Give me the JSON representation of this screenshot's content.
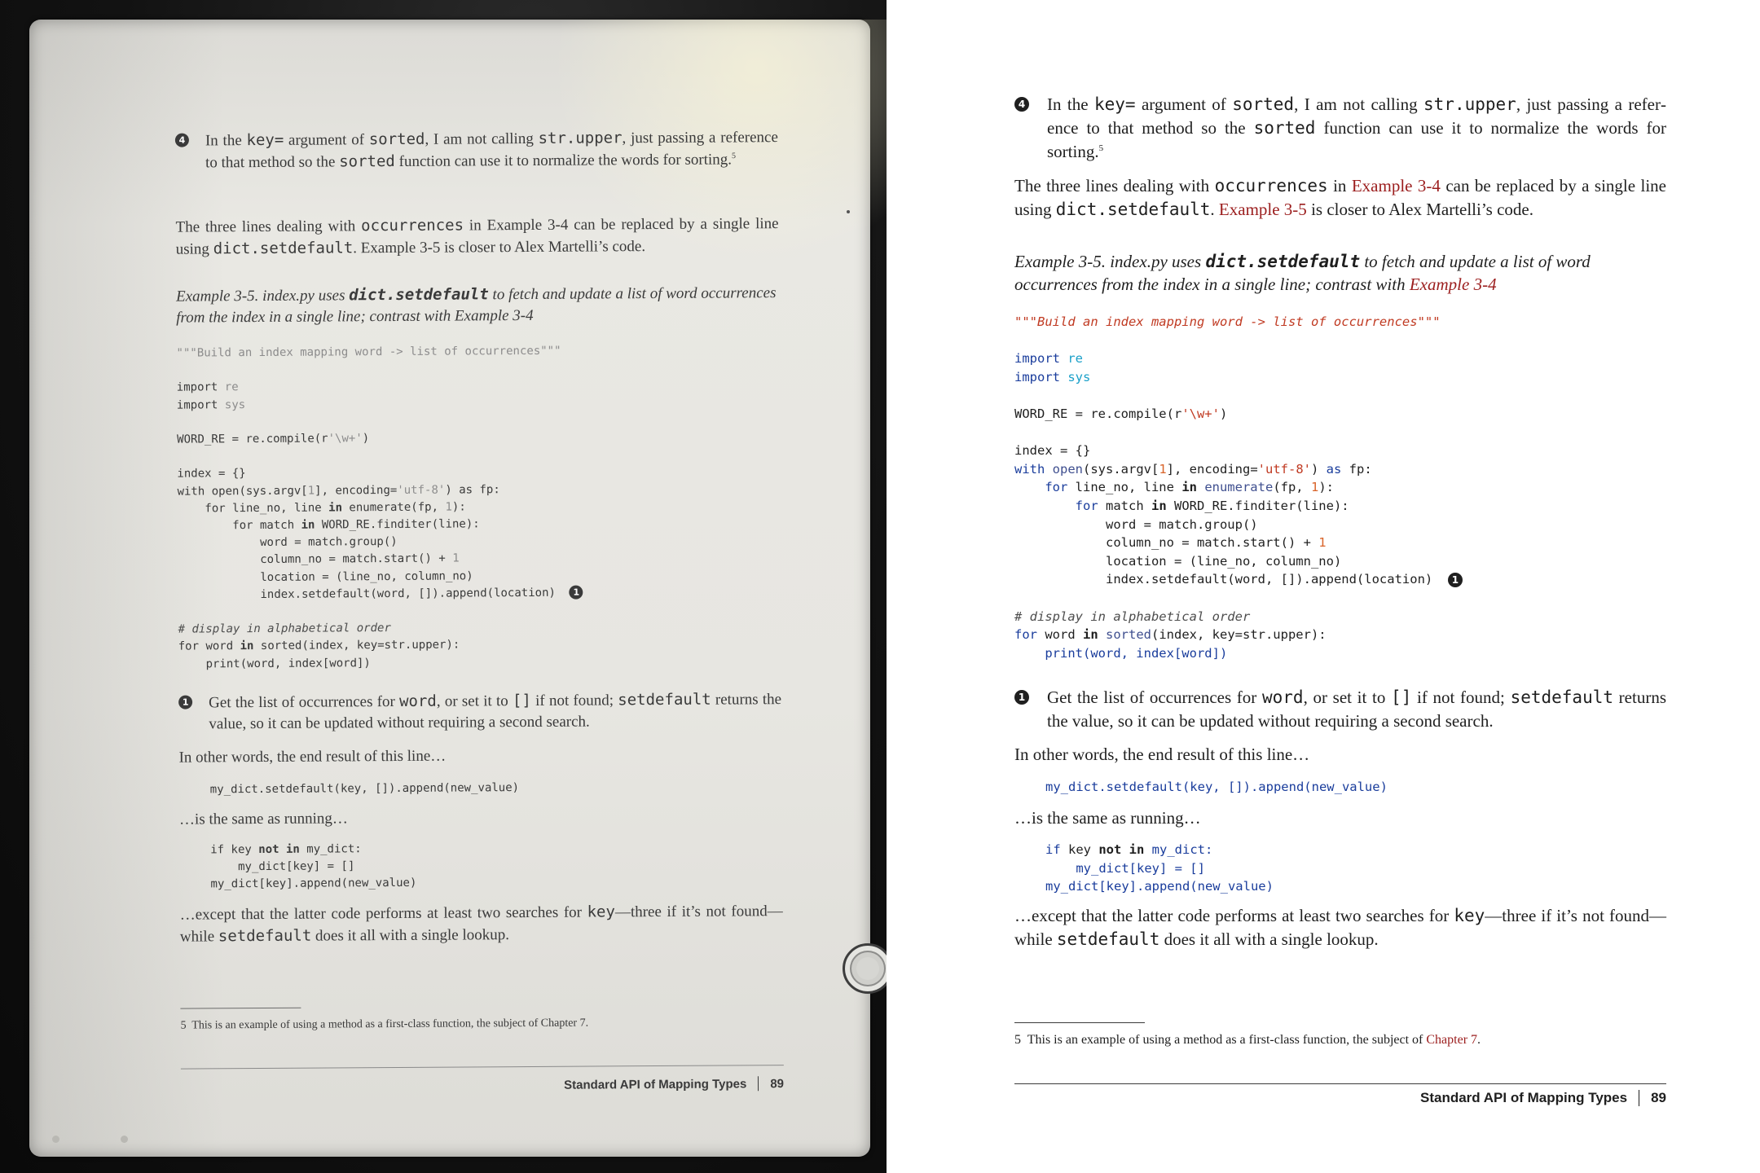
{
  "page": {
    "note4": {
      "marker": "4",
      "t1": "In the ",
      "c1": "key=",
      "t2": " argument of ",
      "c2": "sorted",
      "t3": ", I am not calling ",
      "c3": "str.upper",
      "t4": ", just passing a refer­ence to that method so the ",
      "c4": "sorted",
      "t5": " function can use it to normalize the words for sorting.",
      "sup": "5"
    },
    "para_three_lines": {
      "t1": "The three lines dealing with ",
      "c1": "occurrences",
      "t2": " in ",
      "x1": "Example 3-4",
      "t3": " can be replaced by a single line using ",
      "c2": "dict.setdefault",
      "t4": ". ",
      "x2": "Example 3-5",
      "t5": " is closer to Alex Martelli’s code."
    },
    "caption": {
      "t1": "Example 3-5. index.py uses ",
      "c1": "dict.setdefault",
      "t2": " to fetch and update a list of word occurrences from the index in a single line; contrast with ",
      "x1": "Example 3-4"
    },
    "code": {
      "docstring": "\"\"\"Build an index mapping word -> list of occurrences\"\"\"",
      "import1_kw": "import",
      "import1_mod": "re",
      "import2_kw": "import",
      "import2_mod": "sys",
      "word_re": "WORD_RE = re.compile(r",
      "word_re_str": "'\\w+'",
      "word_re_end": ")",
      "index_init": "index = {}",
      "with_kw": "with",
      "with_open": " open",
      "with_mid": "(sys.argv[",
      "with_one": "1",
      "with_mid2": "], encoding=",
      "with_enc": "'utf-8'",
      "with_mid3": ") ",
      "with_as": "as",
      "with_end": " fp:",
      "for1_kw": "for",
      "for1_mid": " line_no, line ",
      "for1_in": "in",
      "for1_fn": " enumerate",
      "for1_end": "(fp, ",
      "for1_one": "1",
      "for1_close": "):",
      "for2_kw": "for",
      "for2_mid": " match ",
      "for2_in": "in",
      "for2_end": " WORD_RE.finditer(line):",
      "word_line": "word = match.group()",
      "col_line": "column_no = match.start() + ",
      "col_one": "1",
      "loc_line": "location = (line_no, column_no)",
      "setdef_line": "index.setdefault(word, []).append(location)",
      "callout": "1",
      "comment": "# display in alphabetical order",
      "for3_kw": "for",
      "for3_mid": " word ",
      "for3_in": "in",
      "for3_fn": " sorted",
      "for3_end": "(index, key=str.upper):",
      "print_line": "print(word, index[word])"
    },
    "note1": {
      "marker": "1",
      "t1": "Get the list of occurrences for ",
      "c1": "word",
      "t2": ", or set it to ",
      "c2": "[]",
      "t3": " if not found; ",
      "c3": "setdefault",
      "t4": " returns the value, so it can be updated without requiring a second search."
    },
    "para_other_words": "In other words, the end result of this line…",
    "code_setdefault": "my_dict.setdefault(key, []).append(new_value)",
    "para_same_as": "…is the same as running…",
    "code_if": {
      "if_kw": "if",
      "if_mid": " key ",
      "not_kw": "not in",
      "if_end": " my_dict:",
      "assign": "    my_dict[key] = []",
      "append": "my_dict[key].append(new_value)"
    },
    "para_except": {
      "t1": "…except that the latter code performs at least two searches for ",
      "c1": "key",
      "t2": "—three if it’s not found—while ",
      "c2": "setdefault",
      "t3": " does it all with a single lookup."
    },
    "footnote": {
      "num": "5",
      "t1": "This is an example of using a method as a first-class function, the subject of ",
      "x1": "Chapter 7",
      "t2": "."
    },
    "running_head": {
      "title": "Standard API of Mapping Types",
      "page_number": "89"
    }
  },
  "colors": {
    "xref": "#9b1d1d",
    "keyword": "#1a3d9c",
    "string": "#c03a22",
    "number": "#d9642a",
    "module": "#1aa0c9"
  }
}
